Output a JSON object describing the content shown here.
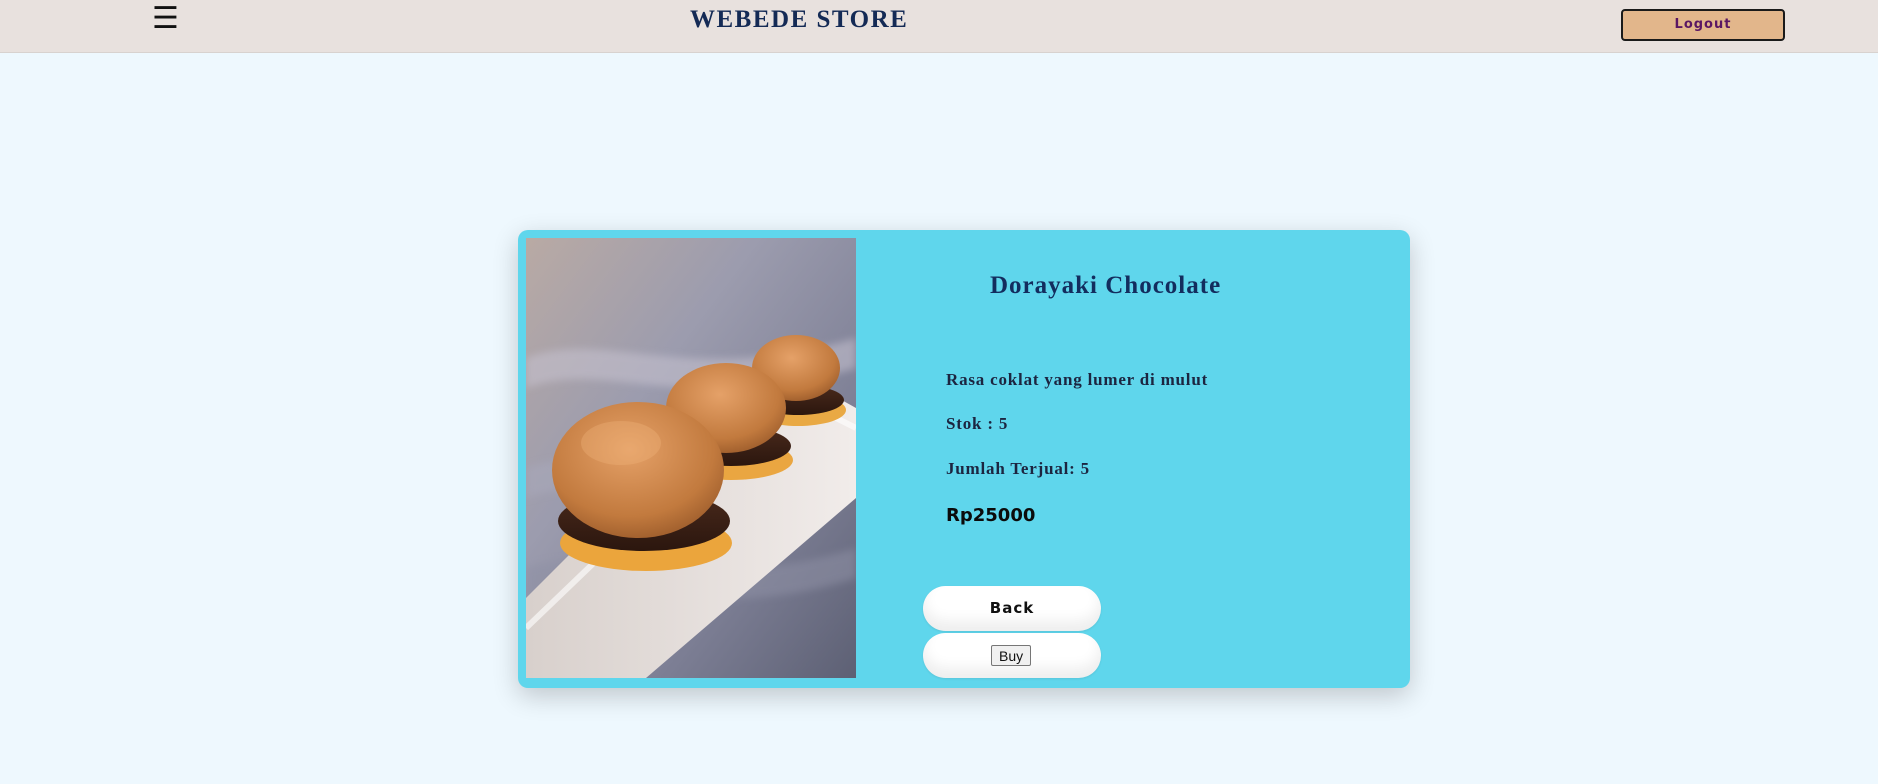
{
  "header": {
    "menu_icon": "hamburger-menu-icon",
    "menu_glyph": "☰",
    "brand": "WEBEDE STORE",
    "logout_label": "Logout"
  },
  "product": {
    "image": "dorayaki-photo",
    "name": "Dorayaki Chocolate",
    "description": "Rasa coklat yang lumer di mulut",
    "stock": "Stok : 5",
    "sold": "Jumlah Terjual: 5",
    "price": "Rp25000"
  },
  "actions": {
    "back_label": "Back",
    "buy_label": "Buy"
  },
  "colors": {
    "page_bg": "#eef8fe",
    "header_bg": "#e8e1de",
    "card_bg": "#5fd6ec",
    "brand_text": "#142a55",
    "logout_bg": "#e2b68b",
    "logout_text": "#5a1663"
  }
}
